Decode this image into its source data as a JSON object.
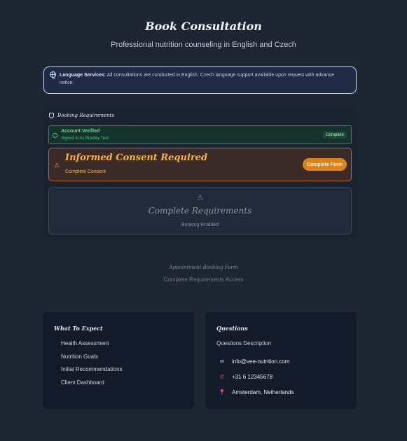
{
  "page": {
    "title": "Book Consultation",
    "subtitle": "Professional nutrition counseling in English and Czech"
  },
  "language_notice": {
    "label": "Language Services:",
    "text": " All consultations are conducted in English. Czech language support available upon request with advance notice."
  },
  "requirements": {
    "header": "Booking Requirements",
    "verified": {
      "title": "Account Verified",
      "subtitle": "Signed in As Bradley Test",
      "badge": "Complete"
    },
    "consent": {
      "title": "Informed Consent Required",
      "subtitle": "Complete Consent",
      "button": "Complete Form"
    },
    "complete": {
      "title": "Complete Requirements",
      "subtitle": "Booking Enabled"
    }
  },
  "booking_form": {
    "title": "Appointment Booking Form",
    "subtitle": "Complete Requirements Access"
  },
  "what_to_expect": {
    "title": "What To Expect",
    "items": [
      "Health Assessment",
      "Nutrition Goals",
      "Initial Recommendations",
      "Client Dashboard"
    ]
  },
  "questions": {
    "title": "Questions",
    "description": "Questions Description",
    "email": "info@vee-nutrition.com",
    "phone": "+31 6 12345678",
    "location": "Amsterdam, Netherlands",
    "icons": [
      "envelope-icon",
      "phone-icon",
      "pin-icon"
    ]
  },
  "colors": {
    "background": "#1e2533",
    "success": "#5ae09a",
    "warning": "#e08314",
    "info_border": "#c9d7f5"
  }
}
